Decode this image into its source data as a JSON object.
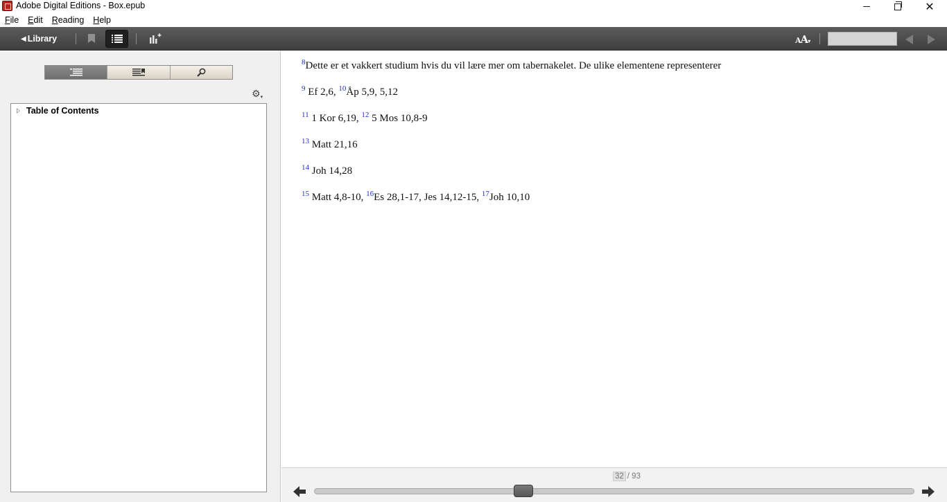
{
  "window": {
    "title": "Adobe Digital Editions - Box.epub",
    "minimize_glyph": "",
    "close_glyph": "✕"
  },
  "menu": {
    "items": [
      {
        "first": "F",
        "rest": "ile"
      },
      {
        "first": "E",
        "rest": "dit"
      },
      {
        "first": "R",
        "rest": "eading"
      },
      {
        "first": "H",
        "rest": "elp"
      }
    ]
  },
  "toolbar": {
    "library_label": "Library",
    "library_arrow": "◀",
    "font_size_big": "A",
    "font_size_small": "A",
    "font_size_caret": "▾",
    "search_value": ""
  },
  "sidebar": {
    "gear_glyph": "⚙",
    "gear_caret": "▾",
    "toc_root_label": "Table of Contents"
  },
  "content": {
    "paragraphs": [
      [
        {
          "sup": "8"
        },
        {
          "text": "Dette er et vakkert studium hvis du vil lære mer om tabernakelet. De ulike elementene representerer"
        }
      ],
      [
        {
          "sup": "9"
        },
        {
          "text": " Ef 2,6, "
        },
        {
          "sup": "10"
        },
        {
          "text": "Åp 5,9, 5,12"
        }
      ],
      [
        {
          "sup": "11"
        },
        {
          "text": " 1 Kor 6,19, "
        },
        {
          "sup": "12"
        },
        {
          "text": " 5 Mos 10,8-9"
        }
      ],
      [
        {
          "sup": "13"
        },
        {
          "text": " Matt 21,16"
        }
      ],
      [
        {
          "sup": "14"
        },
        {
          "text": " Joh 14,28"
        }
      ],
      [
        {
          "sup": "15"
        },
        {
          "text": " Matt 4,8-10, "
        },
        {
          "sup": "16"
        },
        {
          "text": "Es 28,1-17, Jes 14,12-15, "
        },
        {
          "sup": "17"
        },
        {
          "text": "Joh 10,10"
        }
      ]
    ]
  },
  "footer": {
    "current_page": "32",
    "page_separator": "/ 93",
    "total_pages": 93,
    "slider_position": 0.344
  },
  "colors": {
    "toolbar": "#4a4a4a",
    "footnote_ref": "#1f2fc7",
    "app_icon": "#b0281e"
  }
}
